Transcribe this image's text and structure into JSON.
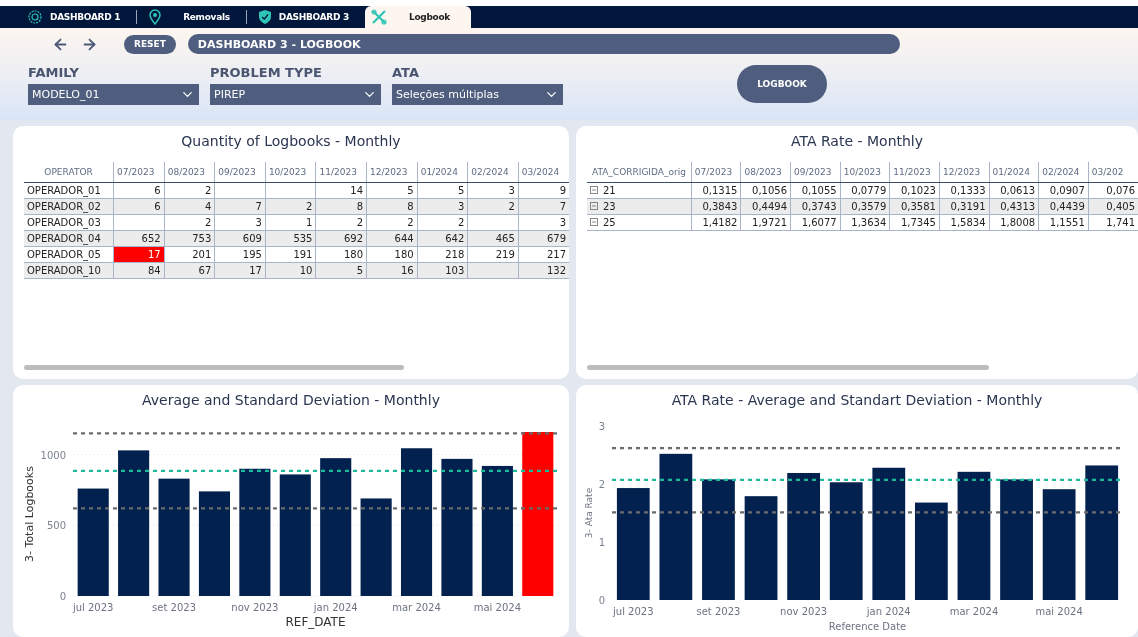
{
  "tabs": [
    {
      "label": "DASHBOARD 1",
      "selected": false
    },
    {
      "label": "Removals",
      "selected": false
    },
    {
      "label": "DASHBOARD 3",
      "selected": false
    },
    {
      "label": "Logbook",
      "selected": true
    }
  ],
  "header": {
    "reset_button": "RESET",
    "title": "DASHBOARD 3 - LOGBOOK"
  },
  "filters": [
    {
      "label": "FAMILY",
      "value": "MODELO_01"
    },
    {
      "label": "PROBLEM TYPE",
      "value": "PIREP"
    },
    {
      "label": "ATA",
      "value": "Seleções múltiplas"
    }
  ],
  "logbook_button": "LOGBOOK",
  "quantity_table": {
    "title": "Quantity of Logbooks - Monthly",
    "columns": [
      "OPERATOR",
      "07/2023",
      "08/2023",
      "09/2023",
      "10/2023",
      "11/2023",
      "12/2023",
      "01/2024",
      "02/2024",
      "03/2024"
    ],
    "rows": [
      {
        "cells": [
          "OPERADOR_01",
          "6",
          "2",
          "",
          "",
          "14",
          "5",
          "5",
          "3",
          "9"
        ],
        "alert": [
          false,
          false,
          false,
          false,
          false,
          false,
          false,
          false,
          false,
          false
        ]
      },
      {
        "cells": [
          "OPERADOR_02",
          "6",
          "4",
          "7",
          "2",
          "8",
          "8",
          "3",
          "2",
          "7"
        ],
        "alert": [
          false,
          false,
          false,
          false,
          false,
          false,
          false,
          false,
          false,
          false
        ]
      },
      {
        "cells": [
          "OPERADOR_03",
          "",
          "2",
          "3",
          "1",
          "2",
          "2",
          "2",
          "",
          "3"
        ],
        "alert": [
          false,
          false,
          false,
          false,
          false,
          false,
          false,
          false,
          false,
          false
        ]
      },
      {
        "cells": [
          "OPERADOR_04",
          "652",
          "753",
          "609",
          "535",
          "692",
          "644",
          "642",
          "465",
          "679"
        ],
        "alert": [
          false,
          false,
          false,
          false,
          false,
          false,
          false,
          false,
          false,
          false
        ]
      },
      {
        "cells": [
          "OPERADOR_05",
          "17",
          "201",
          "195",
          "191",
          "180",
          "180",
          "218",
          "219",
          "217"
        ],
        "alert": [
          false,
          true,
          false,
          false,
          false,
          false,
          false,
          false,
          false,
          false
        ]
      },
      {
        "cells": [
          "OPERADOR_10",
          "84",
          "67",
          "17",
          "10",
          "5",
          "16",
          "103",
          "",
          "132"
        ],
        "alert": [
          false,
          false,
          false,
          false,
          false,
          false,
          false,
          false,
          false,
          false
        ]
      }
    ]
  },
  "rate_table": {
    "title": "ATA Rate - Monthly",
    "columns": [
      "ATA_CORRIGIDA_orig",
      "07/2023",
      "08/2023",
      "09/2023",
      "10/2023",
      "11/2023",
      "12/2023",
      "01/2024",
      "02/2024",
      "03/202"
    ],
    "rows": [
      {
        "cells": [
          "21",
          "0,1315",
          "0,1056",
          "0,1055",
          "0,0779",
          "0,1023",
          "0,1333",
          "0,0613",
          "0,0907",
          "0,076"
        ]
      },
      {
        "cells": [
          "23",
          "0,3843",
          "0,4494",
          "0,3743",
          "0,3579",
          "0,3581",
          "0,3191",
          "0,4313",
          "0,4439",
          "0,405"
        ]
      },
      {
        "cells": [
          "25",
          "1,4182",
          "1,9721",
          "1,6077",
          "1,3634",
          "1,7345",
          "1,5834",
          "1,8008",
          "1,1551",
          "1,741"
        ]
      }
    ]
  },
  "average_chart": {
    "chart_data": {
      "type": "bar",
      "title": "Average and Standard Deviation - Monthly",
      "xlabel": "REF_DATE",
      "ylabel": "3- Total Logbooks",
      "categories": [
        "jul 2023",
        null,
        "set 2023",
        null,
        "nov 2023",
        null,
        "jan 2024",
        null,
        "mar 2024",
        null,
        "mai 2024",
        null
      ],
      "series": [
        {
          "color": "#03214f",
          "values": [
            760,
            1030,
            830,
            740,
            900,
            860,
            975,
            690,
            1045,
            970,
            920,
            null
          ]
        },
        {
          "color": "#ff0000",
          "values": [
            null,
            null,
            null,
            null,
            null,
            null,
            null,
            null,
            null,
            null,
            null,
            1160
          ]
        }
      ],
      "stacked": true,
      "ylim": [
        0,
        1160
      ],
      "yticks": [
        0,
        500,
        1000
      ],
      "ref_lines": [
        {
          "axis": "y",
          "value": 1150,
          "color": "#6b6b6b"
        },
        {
          "axis": "y",
          "value": 885,
          "color": "#1abc9c"
        },
        {
          "axis": "y",
          "value": 620,
          "color": "#6b6b6b"
        }
      ]
    }
  },
  "rate_chart": {
    "chart_data": {
      "type": "bar",
      "title": "ATA Rate - Average and Standart Deviation - Monthly",
      "xlabel": "Reference Date",
      "ylabel": "3- Ata Rate",
      "categories": [
        "jul 2023",
        null,
        "set 2023",
        null,
        "nov 2023",
        null,
        "jan 2024",
        null,
        "mar 2024",
        null,
        "mai 2024",
        null
      ],
      "series": [
        {
          "color": "#03214f",
          "values": [
            1.93,
            2.52,
            2.08,
            1.79,
            2.19,
            2.03,
            2.28,
            1.68,
            2.21,
            2.08,
            1.91,
            2.32
          ]
        }
      ],
      "ylim": [
        0,
        3
      ],
      "yticks": [
        0,
        1,
        2,
        3
      ],
      "ref_lines": [
        {
          "axis": "y",
          "value": 2.62,
          "color": "#6b6b6b"
        },
        {
          "axis": "y",
          "value": 2.07,
          "color": "#1abc9c"
        },
        {
          "axis": "y",
          "value": 1.51,
          "color": "#6b6b6b"
        }
      ]
    }
  }
}
